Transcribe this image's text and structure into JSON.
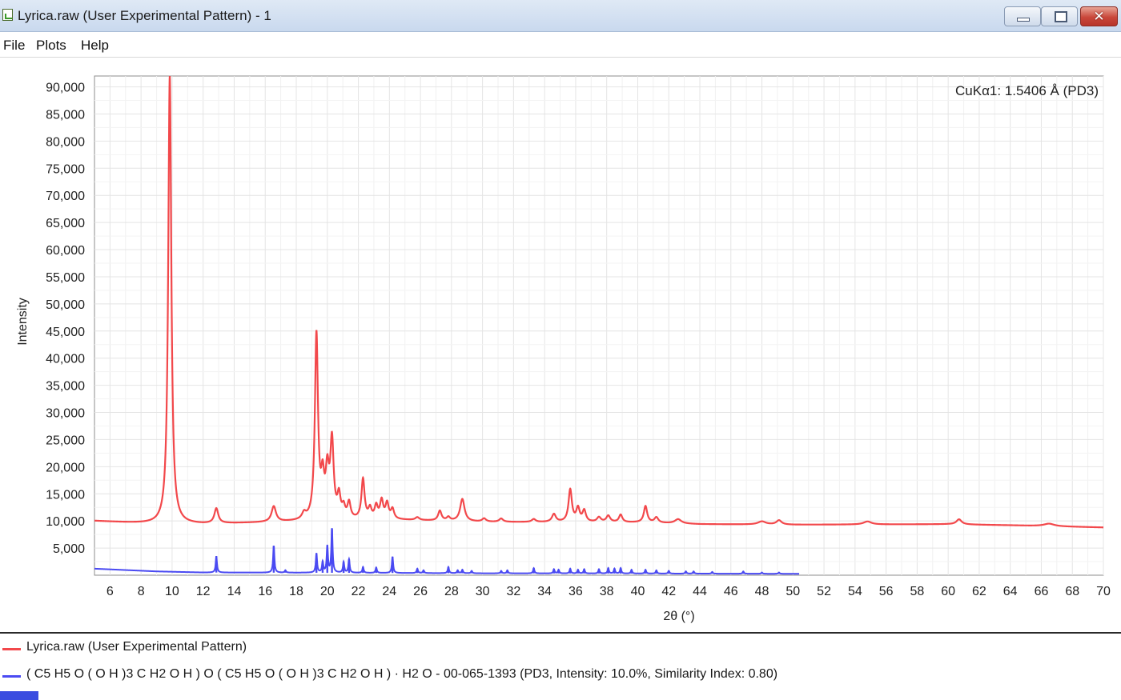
{
  "window": {
    "title": "Lyrica.raw (User Experimental Pattern) - 1"
  },
  "menu": {
    "items": [
      "File",
      "Plots",
      "Help"
    ]
  },
  "colors": {
    "experimental": "#f2484b",
    "reference": "#4a4af2",
    "grid": "#e4e4e4"
  },
  "chart_data": {
    "type": "line",
    "xlabel": "2θ (°)",
    "ylabel": "Intensity",
    "annotation": "CuKα1: 1.5406 Å (PD3)",
    "xlim": [
      5,
      70
    ],
    "ylim": [
      0,
      92000
    ],
    "xticks": [
      6,
      8,
      10,
      12,
      14,
      16,
      18,
      20,
      22,
      24,
      26,
      28,
      30,
      32,
      34,
      36,
      38,
      40,
      42,
      44,
      46,
      48,
      50,
      52,
      54,
      56,
      58,
      60,
      62,
      64,
      66,
      68,
      70
    ],
    "xtick_labels": [
      "6",
      "8",
      "10",
      "12",
      "14",
      "16",
      "18",
      "20",
      "22",
      "24",
      "26",
      "28",
      "30",
      "32",
      "34",
      "36",
      "38",
      "40",
      "42",
      "44",
      "46",
      "48",
      "50",
      "52",
      "54",
      "56",
      "58",
      "60",
      "62",
      "64",
      "66",
      "68",
      "70"
    ],
    "yticks": [
      5000,
      10000,
      15000,
      20000,
      25000,
      30000,
      35000,
      40000,
      45000,
      50000,
      55000,
      60000,
      65000,
      70000,
      75000,
      80000,
      85000,
      90000
    ],
    "ytick_labels": [
      "5,000",
      "10,000",
      "15,000",
      "20,000",
      "25,000",
      "30,000",
      "35,000",
      "40,000",
      "45,000",
      "50,000",
      "55,000",
      "60,000",
      "65,000",
      "70,000",
      "75,000",
      "80,000",
      "85,000",
      "90,000"
    ],
    "grid": true,
    "legend_placement": "bottom",
    "series": [
      {
        "name": "Lyrica.raw (User Experimental Pattern)",
        "color": "#f2484b",
        "baseline": [
          [
            5,
            10000
          ],
          [
            9,
            9400
          ],
          [
            12,
            9400
          ],
          [
            20,
            10000
          ],
          [
            24,
            10200
          ],
          [
            30,
            9800
          ],
          [
            40,
            9700
          ],
          [
            44,
            9400
          ],
          [
            50,
            9300
          ],
          [
            60,
            9400
          ],
          [
            64,
            9200
          ],
          [
            70,
            8800
          ]
        ],
        "peaks": [
          [
            9.85,
            92000,
            0.12
          ],
          [
            12.85,
            12200,
            0.15
          ],
          [
            16.55,
            12600,
            0.17
          ],
          [
            18.5,
            11000,
            0.15
          ],
          [
            19.3,
            44000,
            0.12
          ],
          [
            19.7,
            16500,
            0.12
          ],
          [
            20.0,
            18000,
            0.13
          ],
          [
            20.3,
            24000,
            0.13
          ],
          [
            20.75,
            14000,
            0.12
          ],
          [
            21.05,
            12000,
            0.12
          ],
          [
            21.4,
            13000,
            0.12
          ],
          [
            22.3,
            17500,
            0.12
          ],
          [
            22.75,
            12000,
            0.12
          ],
          [
            23.15,
            12500,
            0.12
          ],
          [
            23.5,
            13500,
            0.12
          ],
          [
            23.85,
            13000,
            0.12
          ],
          [
            24.2,
            12000,
            0.12
          ],
          [
            25.8,
            10600,
            0.15
          ],
          [
            27.25,
            11800,
            0.13
          ],
          [
            27.8,
            10600,
            0.13
          ],
          [
            28.7,
            14000,
            0.17
          ],
          [
            30.1,
            10400,
            0.15
          ],
          [
            31.2,
            10400,
            0.15
          ],
          [
            33.3,
            10300,
            0.15
          ],
          [
            34.6,
            11200,
            0.15
          ],
          [
            35.65,
            15700,
            0.13
          ],
          [
            36.15,
            12200,
            0.13
          ],
          [
            36.55,
            11800,
            0.13
          ],
          [
            37.5,
            10600,
            0.15
          ],
          [
            38.1,
            10900,
            0.15
          ],
          [
            38.9,
            11100,
            0.13
          ],
          [
            40.5,
            12700,
            0.13
          ],
          [
            41.2,
            10600,
            0.15
          ],
          [
            42.6,
            10300,
            0.25
          ],
          [
            48.0,
            9900,
            0.3
          ],
          [
            49.1,
            10100,
            0.2
          ],
          [
            54.8,
            9900,
            0.3
          ],
          [
            60.7,
            10300,
            0.2
          ],
          [
            66.5,
            9500,
            0.4
          ]
        ]
      },
      {
        "name": "( C5 H5 O ( O H )3 C H2 O H ) O ( C5 H5 O ( O H )3 C H2 O H ) · H2 O - 00-065-1393 (PD3, Intensity: 10.0%, Similarity Index: 0.80)",
        "color": "#4a4af2",
        "baseline": [
          [
            5,
            1200
          ],
          [
            9,
            700
          ],
          [
            12,
            500
          ],
          [
            20,
            450
          ],
          [
            30,
            350
          ],
          [
            40,
            300
          ],
          [
            50.4,
            250
          ]
        ],
        "end": 50.4,
        "sticks": [
          [
            12.85,
            3500
          ],
          [
            16.55,
            5400
          ],
          [
            17.3,
            900
          ],
          [
            19.3,
            4000
          ],
          [
            19.7,
            2400
          ],
          [
            20.0,
            5300
          ],
          [
            20.3,
            8500
          ],
          [
            21.05,
            2400
          ],
          [
            21.4,
            2900
          ],
          [
            22.3,
            1500
          ],
          [
            23.15,
            1400
          ],
          [
            24.2,
            3400
          ],
          [
            25.8,
            1200
          ],
          [
            26.2,
            900
          ],
          [
            27.8,
            1500
          ],
          [
            28.4,
            900
          ],
          [
            28.7,
            1000
          ],
          [
            29.3,
            800
          ],
          [
            31.2,
            800
          ],
          [
            31.6,
            900
          ],
          [
            33.3,
            1300
          ],
          [
            34.6,
            1100
          ],
          [
            34.9,
            1000
          ],
          [
            35.65,
            1200
          ],
          [
            36.15,
            1000
          ],
          [
            36.55,
            1100
          ],
          [
            37.5,
            1100
          ],
          [
            38.1,
            1300
          ],
          [
            38.5,
            1200
          ],
          [
            38.9,
            1300
          ],
          [
            39.6,
            1000
          ],
          [
            40.5,
            1000
          ],
          [
            41.2,
            900
          ],
          [
            42.0,
            800
          ],
          [
            43.1,
            700
          ],
          [
            43.6,
            700
          ],
          [
            44.8,
            600
          ],
          [
            46.8,
            700
          ],
          [
            48.0,
            500
          ],
          [
            49.1,
            500
          ]
        ]
      }
    ]
  },
  "legend": {
    "items": [
      {
        "label": "Lyrica.raw (User Experimental Pattern)",
        "color": "#f2484b"
      },
      {
        "label": "( C5 H5 O ( O H )3 C H2 O H ) O ( C5 H5 O ( O H )3 C H2 O H ) · H2 O - 00-065-1393 (PD3, Intensity: 10.0%, Similarity Index: 0.80)",
        "color": "#4a4af2"
      }
    ]
  }
}
